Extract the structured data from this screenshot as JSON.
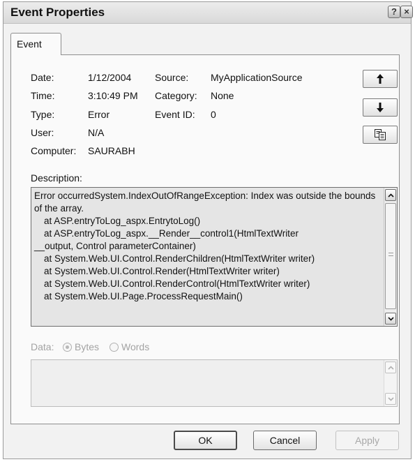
{
  "window": {
    "title": "Event Properties",
    "help_glyph": "?",
    "close_glyph": "×"
  },
  "tabs": [
    {
      "label": "Event",
      "selected": true
    }
  ],
  "fields": {
    "date_label": "Date:",
    "date_value": "1/12/2004",
    "time_label": "Time:",
    "time_value": "3:10:49 PM",
    "type_label": "Type:",
    "type_value": "Error",
    "user_label": "User:",
    "user_value": "N/A",
    "computer_label": "Computer:",
    "computer_value": "SAURABH",
    "source_label": "Source:",
    "source_value": "MyApplicationSource",
    "category_label": "Category:",
    "category_value": "None",
    "event_id_label": "Event ID:",
    "event_id_value": "0"
  },
  "nav": {
    "up_icon": "arrow-up-icon",
    "down_icon": "arrow-down-icon",
    "copy_icon": "copy-icon"
  },
  "description": {
    "label": "Description:",
    "lines": [
      "Error occurredSystem.IndexOutOfRangeException: Index was outside the bounds of the array.",
      "   at ASP.entryToLog_aspx.EntrytoLog()",
      "   at ASP.entryToLog_aspx.__Render__control1(HtmlTextWriter",
      "__output, Control parameterContainer)",
      "   at System.Web.UI.Control.RenderChildren(HtmlTextWriter writer)",
      "   at System.Web.UI.Control.Render(HtmlTextWriter writer)",
      "   at System.Web.UI.Control.RenderControl(HtmlTextWriter writer)",
      "   at System.Web.UI.Page.ProcessRequestMain()"
    ]
  },
  "data": {
    "label": "Data:",
    "bytes_label": "Bytes",
    "words_label": "Words",
    "selected": "Bytes",
    "enabled": false
  },
  "buttons": {
    "ok": "OK",
    "cancel": "Cancel",
    "apply": "Apply"
  },
  "colors": {
    "window_bg": "#f2f2f2",
    "disabled_text": "#a3a3a3",
    "description_bg": "#e5e5e5"
  }
}
